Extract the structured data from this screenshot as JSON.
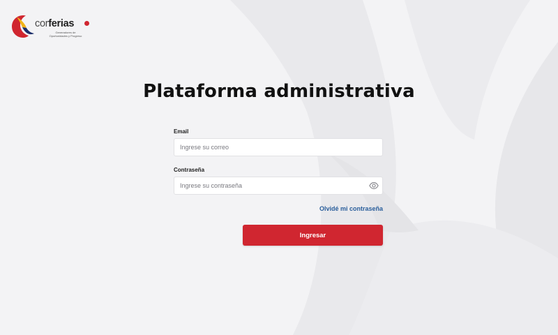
{
  "logo": {
    "brand_part1": "cor",
    "brand_part2": "ferias",
    "tagline_line1": "Generadores de",
    "tagline_line2": "Oportunidades y Progreso"
  },
  "page": {
    "title": "Plataforma administrativa"
  },
  "form": {
    "email_label": "Email",
    "email_placeholder": "Ingrese su correo",
    "password_label": "Contraseña",
    "password_placeholder": "Ingrese su contraseña",
    "toggle_icon": "eye-icon",
    "forgot_label": "Olvidé mi contraseña",
    "submit_label": "Ingresar"
  },
  "colors": {
    "background": "#f3f3f5",
    "accent_red": "#d02630",
    "link_blue": "#2a5e9b",
    "logo_yellow": "#f2b418",
    "logo_navy": "#1c2f6b"
  }
}
